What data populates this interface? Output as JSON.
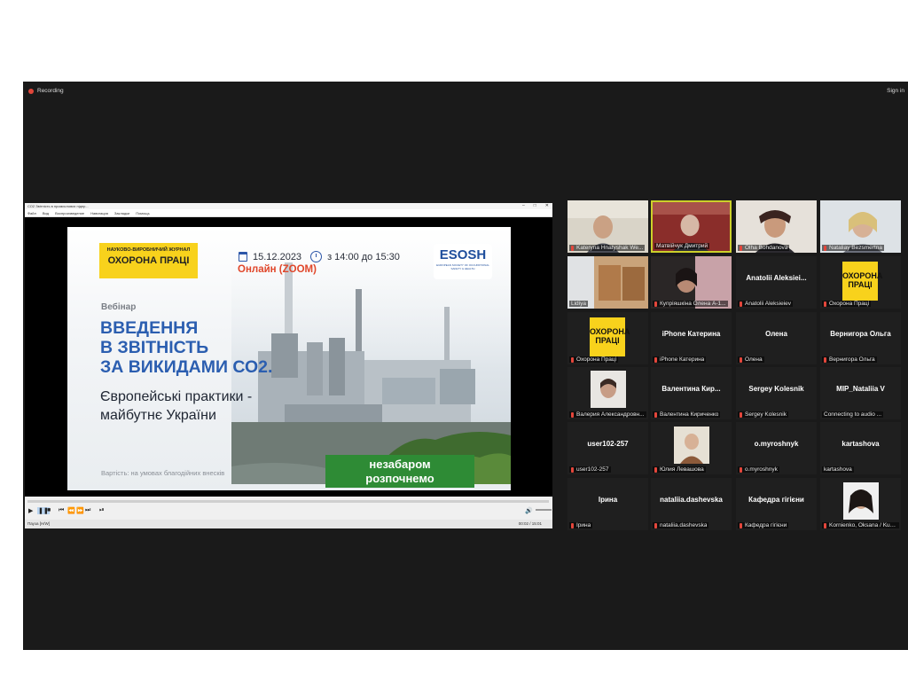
{
  "topbar": {
    "recording_label": "Recording",
    "sign_in_label": "Sign in"
  },
  "player": {
    "title": "СО2 Звітність в промислових підпр...",
    "window_buttons": [
      "–",
      "□",
      "✕"
    ],
    "menu": [
      "Файл",
      "Вид",
      "Воспроизведение",
      "Навигация",
      "Закладки",
      "Помощь"
    ],
    "status": "Пауза [H/W]",
    "time": "00:02 / 15:01"
  },
  "slide": {
    "journal_sub": "НАУКОВО-ВИРОБНИЧИЙ ЖУРНАЛ",
    "journal_name": "ОХОРОНА ПРАЦІ",
    "date": "15.12.2023",
    "time": "з 14:00 до 15:30",
    "online": "Онлайн (ZOOM)",
    "esosh_title": "ESOSH",
    "esosh_sub": "EUROPEAN SOCIETY OF OCCUPATIONAL SAFETY & HEALTH",
    "webinar_label": "Вебінар",
    "title_lines": [
      "ВВЕДЕННЯ",
      "В ЗВІТНІСТЬ",
      "ЗА ВИКИДАМИ СО2."
    ],
    "subtitle_lines": [
      "Європейські практики -",
      "майбутнє України"
    ],
    "price_note": "Вартість: на умовах благодійних внесків",
    "starting_soon_lines": [
      "незабаром",
      "розпочнемо"
    ]
  },
  "participants": [
    {
      "name": "Kateryna Hnatyshak We...",
      "center": ""
    },
    {
      "name": "Матвійчук Дмитрий",
      "center": ""
    },
    {
      "name": "Olha Bohdanova",
      "center": ""
    },
    {
      "name": "Nataliay Bezsmertna",
      "center": ""
    },
    {
      "name": "Lidiya",
      "center": ""
    },
    {
      "name": "Купріяшкіна Олена А-1...",
      "center": ""
    },
    {
      "name": "Anatolii Aleksieiev",
      "center": "Anatolii Aleksiei..."
    },
    {
      "name": "Охорона Праці",
      "center": ""
    },
    {
      "name": "Охорона Праці",
      "center": ""
    },
    {
      "name": "iPhone Катерина",
      "center": "iPhone Катерина"
    },
    {
      "name": "Олена",
      "center": "Олена"
    },
    {
      "name": "Вернигора Ольга",
      "center": "Вернигора Ольга"
    },
    {
      "name": "Валерия Александровн...",
      "center": ""
    },
    {
      "name": "Валентина Кириченко",
      "center": "Валентина Кир..."
    },
    {
      "name": "Sergey Kolesnik",
      "center": "Sergey Kolesnik"
    },
    {
      "name": "Connecting to audio ...",
      "center": "MIP_Nataliia V"
    },
    {
      "name": "user102-257",
      "center": "user102-257"
    },
    {
      "name": "Юлия Левашова",
      "center": ""
    },
    {
      "name": "o.myroshnyk",
      "center": "o.myroshnyk"
    },
    {
      "name": "kartashova",
      "center": "kartashova"
    },
    {
      "name": "Ірина",
      "center": "Ірина"
    },
    {
      "name": "nataliia.dashevska",
      "center": "nataliia.dashevska"
    },
    {
      "name": "Кафедра гігієни",
      "center": "Кафедра гігієни"
    },
    {
      "name": "Kornienko, Oksana / Kue...",
      "center": ""
    }
  ],
  "logo_tile": {
    "line1": "ОХОРОНА",
    "line2": "ПРАЦІ"
  },
  "colors": {
    "accent_yellow": "#f8d21c",
    "title_blue": "#2b5eb0",
    "online_red": "#e0462a",
    "button_green": "#2e8b35",
    "active_speaker": "#ccd02a"
  }
}
